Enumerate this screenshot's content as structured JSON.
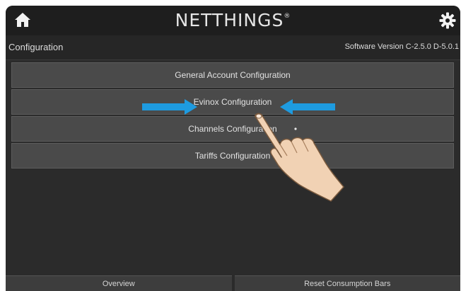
{
  "header": {
    "brand": "NETTHINGS",
    "brand_mark": "®",
    "home_icon": "home-icon",
    "settings_icon": "gear-icon"
  },
  "subheader": {
    "title": "Configuration",
    "version": "Software Version C-2.5.0 D-5.0.1"
  },
  "menu": {
    "items": [
      {
        "label": "General Account Configuration"
      },
      {
        "label": "Evinox Configuration"
      },
      {
        "label": "Channels Configuration"
      },
      {
        "label": "Tariffs Configuration"
      }
    ]
  },
  "overlay": {
    "arrow_color": "#1e9be0",
    "pointer": "pointing-hand-icon"
  },
  "footer": {
    "tabs": [
      {
        "label": "Overview"
      },
      {
        "label": "Reset Consumption Bars"
      }
    ]
  },
  "colors": {
    "background": "#2b2b2b",
    "topbar": "#1e1e1e",
    "button": "#4a4a4a"
  }
}
